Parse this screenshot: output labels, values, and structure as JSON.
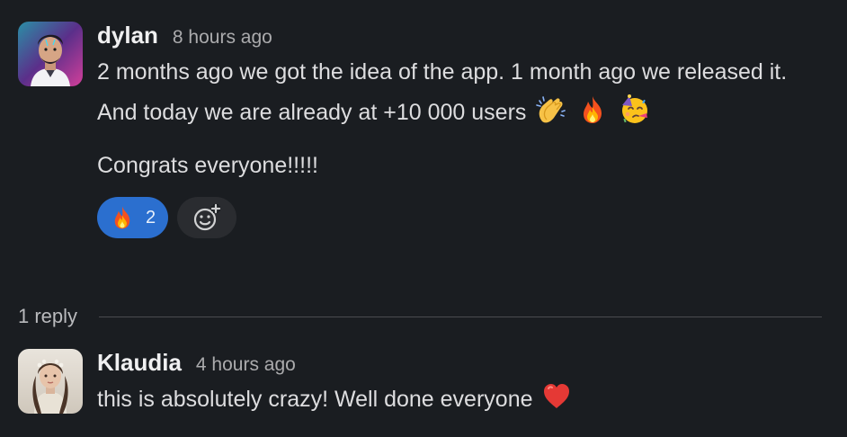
{
  "thread": {
    "root_message": {
      "author": "dylan",
      "timestamp": "8 hours ago",
      "paragraphs": [
        "2 months ago we got the idea of the app. 1 month ago we released it. And today we are already at +10 000 users",
        "Congrats everyone!!!!!"
      ],
      "inline_emojis": [
        "clapping-hands",
        "fire",
        "partying-face"
      ],
      "reactions": [
        {
          "emoji": "fire",
          "count": "2",
          "selected": true
        }
      ],
      "add_reaction_icon": "add-reaction-icon"
    },
    "reply_summary": {
      "label": "1 reply"
    },
    "reply_message": {
      "author": "Klaudia",
      "timestamp": "4 hours ago",
      "text": "this is absolutely crazy! Well done everyone",
      "inline_emojis": [
        "red-heart"
      ]
    }
  },
  "colors": {
    "background": "#1a1d21",
    "reaction_selected": "#2b6fcf",
    "reaction_button": "#2a2c30",
    "divider": "#4a4c50"
  }
}
